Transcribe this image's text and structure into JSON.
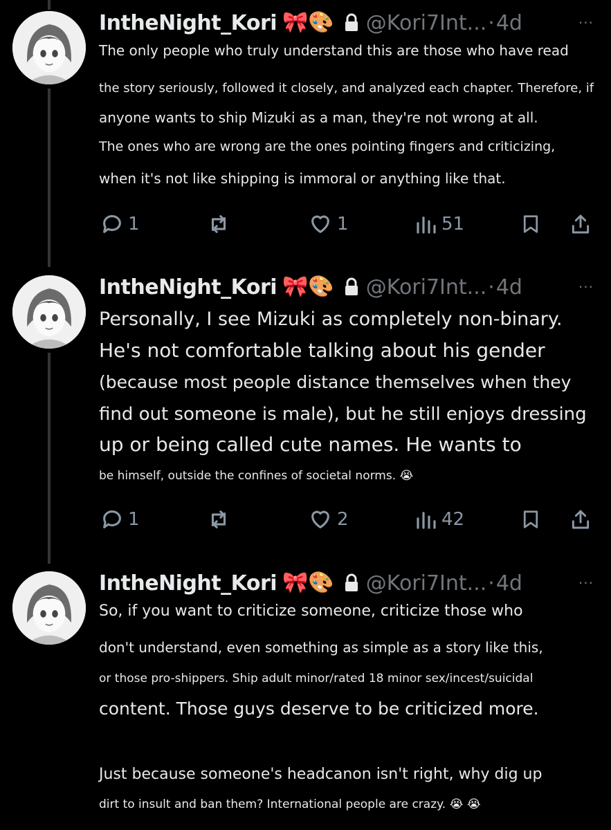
{
  "theme": {
    "background": "#000000",
    "text": "#e7e9ea",
    "muted": "#71767b",
    "action": "#8b98a5",
    "thread_line": "#333639"
  },
  "posts": [
    {
      "display_name": "IntheNight_Kori",
      "emojis": "🎀🎨",
      "handle": "@Kori7Int...",
      "separator": "·",
      "time": "4d",
      "more": "···",
      "lines": [
        "The only people who truly understand this are those who have read",
        "the story seriously, followed it closely, and analyzed each chapter. Therefore, if",
        "anyone wants to ship Mizuki as a man, they're not wrong at all.",
        "The ones who are wrong are the ones pointing fingers and criticizing,",
        "when it's not like shipping is immoral or anything like that."
      ],
      "stats": {
        "replies": "1",
        "reposts": "",
        "likes": "1",
        "views": "51"
      }
    },
    {
      "display_name": "IntheNight_Kori",
      "emojis": "🎀🎨",
      "handle": "@Kori7Int...",
      "separator": "·",
      "time": "4d",
      "more": "···",
      "lines": [
        "Personally, I see Mizuki as completely non-binary.",
        "He's not comfortable talking about his gender",
        "(because most people distance themselves when they",
        "find out someone is male), but he still enjoys dressing",
        "up or being called cute names. He wants to",
        "be himself, outside the confines of societal norms. 😭"
      ],
      "stats": {
        "replies": "1",
        "reposts": "",
        "likes": "2",
        "views": "42"
      }
    },
    {
      "display_name": "IntheNight_Kori",
      "emojis": "🎀🎨",
      "handle": "@Kori7Int...",
      "separator": "·",
      "time": "4d",
      "more": "···",
      "lines": [
        "So, if you want to criticize someone, criticize those who",
        "don't understand, even something as simple as a story like this,",
        "or those pro-shippers. Ship adult minor/rated 18 minor sex/incest/suicidal",
        "content. Those guys deserve to be criticized more.",
        "Just because someone's headcanon isn't right, why dig up",
        "dirt to insult and ban them? International people are crazy. 😭 😭"
      ]
    }
  ]
}
